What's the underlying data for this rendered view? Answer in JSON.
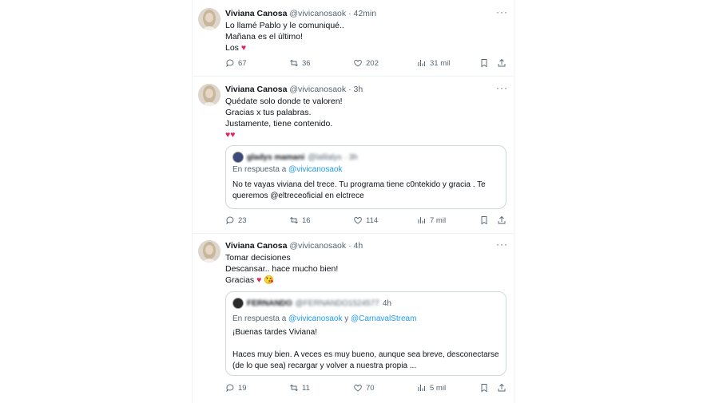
{
  "tweets": [
    {
      "name": "Viviana Canosa",
      "handle": "@vivicanosaok",
      "time": "· 42min",
      "lines": [
        "Lo llamé Pablo y le comuniqué..",
        "Mañana es el último!",
        "Los"
      ],
      "emoji_line3": "♥",
      "stats": {
        "replies": "67",
        "retweets": "36",
        "likes": "202",
        "views": "31 mil"
      }
    },
    {
      "name": "Viviana Canosa",
      "handle": "@vivicanosaok",
      "time": "· 3h",
      "lines": [
        "Quédate solo donde te valoren!",
        "Gracias x tus palabras.",
        "Justamente, tiene contenido."
      ],
      "emoji_line4": "♥♥",
      "quote": {
        "author": "gladys mamani",
        "author_handle": "@lalilalys · 3h",
        "reply_prefix": "En respuesta a",
        "reply_to": "@vivicanosaok",
        "reply_and": "",
        "reply_to2": "",
        "text": "No te vayas viviana del trece. Tu programa tiene c0ntekido y gracia . Te queremos @eltreceoficial en elctrece"
      },
      "stats": {
        "replies": "23",
        "retweets": "16",
        "likes": "114",
        "views": "7 mil"
      }
    },
    {
      "name": "Viviana Canosa",
      "handle": "@vivicanosaok",
      "time": "· 4h",
      "lines": [
        "Tomar decisiones",
        "Descansar.. hace mucho bien!",
        "Gracias"
      ],
      "emoji_line3": "♥ 😘",
      "quote": {
        "author": "FERNANDO",
        "author_handle": "@FERNANDO1524577",
        "time": "4h",
        "reply_prefix": "En respuesta a",
        "reply_to": "@vivicanosaok",
        "reply_and": "y",
        "reply_to2": "@CarnavalStream",
        "text1": "¡Buenas tardes Viviana!",
        "text2": "Haces muy bien. A veces es muy bueno, aunque sea breve, desconectarse (de lo que sea) recargar y volver a nuestra propia ..."
      },
      "stats": {
        "replies": "19",
        "retweets": "11",
        "likes": "70",
        "views": "5 mil"
      }
    }
  ],
  "icons": {
    "more": "···",
    "reply": "reply-icon",
    "retweet": "retweet-icon",
    "like": "heart-icon",
    "views": "views-icon",
    "bookmark": "bookmark-icon",
    "share": "share-icon"
  },
  "colors": {
    "text": "#0f1419",
    "muted": "#536471",
    "link": "#1d9bf0",
    "heart": "#e0245e",
    "border": "#cfd9de"
  }
}
